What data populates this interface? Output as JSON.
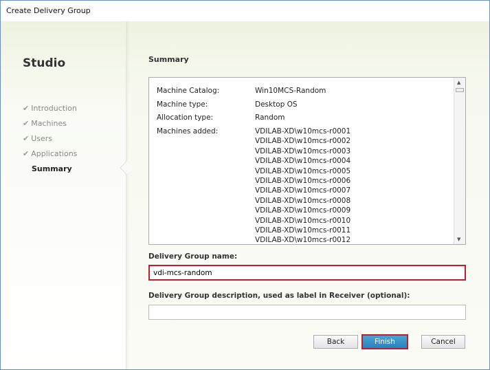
{
  "window": {
    "title": "Create Delivery Group"
  },
  "sidebar": {
    "brand": "Studio",
    "steps": [
      {
        "label": "Introduction",
        "done": true
      },
      {
        "label": "Machines",
        "done": true
      },
      {
        "label": "Users",
        "done": true
      },
      {
        "label": "Applications",
        "done": true
      },
      {
        "label": "Summary",
        "done": false,
        "active": true
      }
    ],
    "check_icon": "✔"
  },
  "main": {
    "heading": "Summary",
    "summary": {
      "rows": [
        {
          "label": "Machine Catalog:",
          "value": "Win10MCS-Random"
        },
        {
          "label": "Machine type:",
          "value": "Desktop OS"
        },
        {
          "label": "Allocation type:",
          "value": "Random"
        },
        {
          "label": "Machines added:"
        }
      ],
      "machines": [
        "VDILAB-XD\\w10mcs-r0001",
        "VDILAB-XD\\w10mcs-r0002",
        "VDILAB-XD\\w10mcs-r0003",
        "VDILAB-XD\\w10mcs-r0004",
        "VDILAB-XD\\w10mcs-r0005",
        "VDILAB-XD\\w10mcs-r0006",
        "VDILAB-XD\\w10mcs-r0007",
        "VDILAB-XD\\w10mcs-r0008",
        "VDILAB-XD\\w10mcs-r0009",
        "VDILAB-XD\\w10mcs-r0010",
        "VDILAB-XD\\w10mcs-r0011",
        "VDILAB-XD\\w10mcs-r0012"
      ]
    },
    "name_label": "Delivery Group name:",
    "name_value": "vdi-mcs-random",
    "desc_label": "Delivery Group description, used as label in Receiver (optional):",
    "desc_value": ""
  },
  "buttons": {
    "back": "Back",
    "finish": "Finish",
    "cancel": "Cancel"
  },
  "colors": {
    "highlight": "#b8202f",
    "primary": "#2a82bd"
  }
}
